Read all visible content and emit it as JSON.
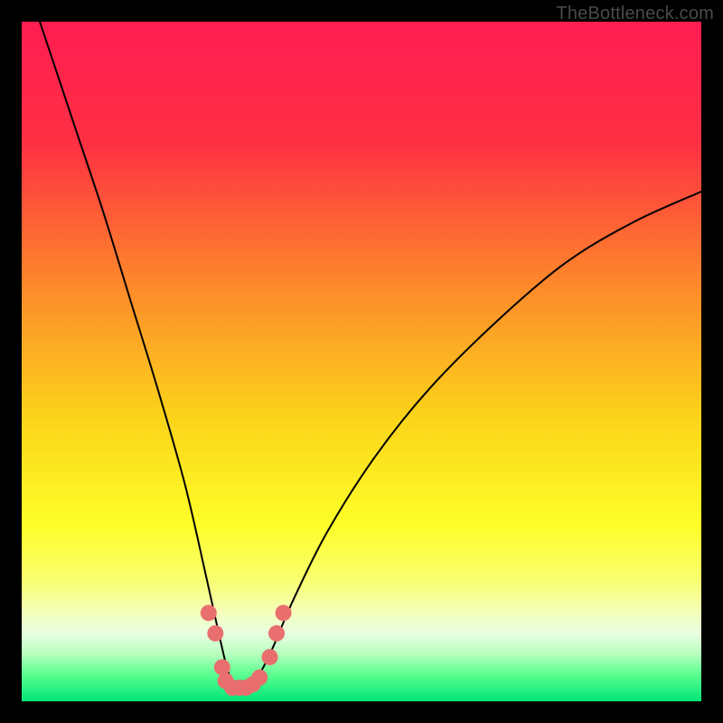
{
  "watermark": "TheBottleneck.com",
  "chart_data": {
    "type": "line",
    "title": "",
    "xlabel": "",
    "ylabel": "",
    "xlim": [
      0,
      100
    ],
    "ylim": [
      0,
      100
    ],
    "grid": false,
    "legend": false,
    "background": {
      "gradient_stops": [
        {
          "offset": 0,
          "color": "#ff1d52"
        },
        {
          "offset": 18,
          "color": "#ff3043"
        },
        {
          "offset": 40,
          "color": "#fd8e29"
        },
        {
          "offset": 58,
          "color": "#fbd31a"
        },
        {
          "offset": 74,
          "color": "#fefe28"
        },
        {
          "offset": 82,
          "color": "#f9ff6e"
        },
        {
          "offset": 87,
          "color": "#f4ffbc"
        },
        {
          "offset": 90,
          "color": "#e8ffe1"
        },
        {
          "offset": 93,
          "color": "#b8ffbe"
        },
        {
          "offset": 96,
          "color": "#5cff90"
        },
        {
          "offset": 100,
          "color": "#00e676"
        }
      ]
    },
    "series": [
      {
        "name": "bottleneck-curve",
        "x": [
          0,
          4,
          8,
          12,
          16,
          20,
          24,
          27,
          29,
          30.5,
          32,
          33.5,
          35,
          37,
          40,
          45,
          52,
          60,
          70,
          80,
          90,
          100
        ],
        "y": [
          108,
          96,
          84,
          72,
          59,
          46,
          32,
          19,
          10,
          4,
          2,
          2,
          4,
          8,
          15,
          25,
          36,
          46,
          56,
          64.5,
          70.5,
          75
        ],
        "color": "#000000",
        "linewidth": 2
      }
    ],
    "markers": {
      "name": "trough-markers",
      "points": [
        {
          "x": 27.5,
          "y": 13
        },
        {
          "x": 28.5,
          "y": 10
        },
        {
          "x": 29.5,
          "y": 5
        },
        {
          "x": 30.0,
          "y": 3
        },
        {
          "x": 31.0,
          "y": 2
        },
        {
          "x": 32.0,
          "y": 2
        },
        {
          "x": 33.0,
          "y": 2
        },
        {
          "x": 34.0,
          "y": 2.5
        },
        {
          "x": 35.0,
          "y": 3.5
        },
        {
          "x": 36.5,
          "y": 6.5
        },
        {
          "x": 37.5,
          "y": 10
        },
        {
          "x": 38.5,
          "y": 13
        }
      ],
      "color": "#e96f6f",
      "size": 9
    }
  }
}
